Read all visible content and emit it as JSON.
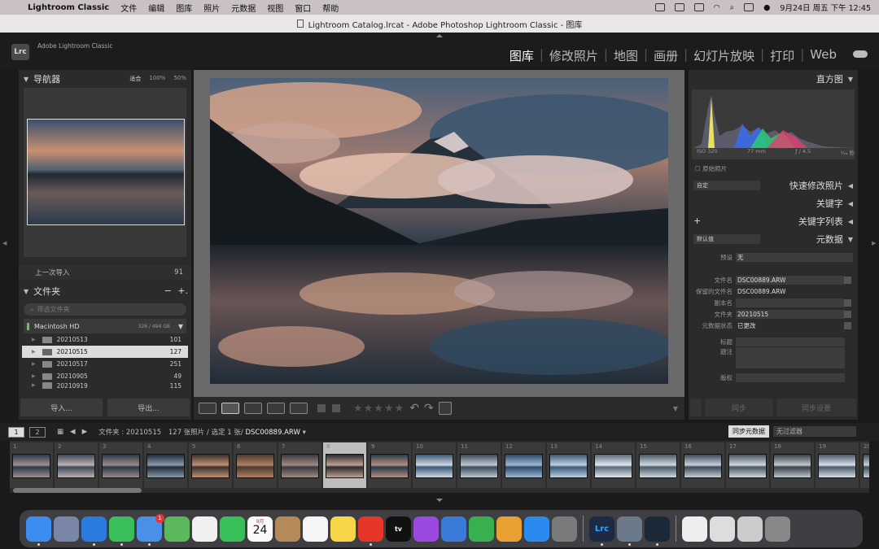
{
  "menubar": {
    "app": "Lightroom Classic",
    "items": [
      "文件",
      "编辑",
      "图库",
      "照片",
      "元数据",
      "视图",
      "窗口",
      "帮助"
    ],
    "clock": "9月24日 周五 下午 12:45"
  },
  "window": {
    "title": "Lightroom Catalog.lrcat - Adobe Photoshop Lightroom Classic - 图库"
  },
  "lr": {
    "logo": "Lrc",
    "brand": "Adobe Lightroom Classic",
    "modules": [
      "图库",
      "修改照片",
      "地图",
      "画册",
      "幻灯片放映",
      "打印",
      "Web"
    ],
    "active_module": "图库"
  },
  "navigator": {
    "title": "导航器",
    "zoom_options": [
      "适合",
      "100%",
      "50%"
    ],
    "selected_zoom": "适合"
  },
  "catalog": {
    "last_import_label": "上一次导入",
    "last_import_count": "91"
  },
  "folders": {
    "title": "文件夹",
    "minus": "−",
    "plus": "+.",
    "search_placeholder": "筛选文件夹",
    "volume_name": "Macintosh HD",
    "volume_size": "326 / 494 GB",
    "rows": [
      {
        "name": "20210513",
        "count": "101"
      },
      {
        "name": "20210515",
        "count": "127"
      },
      {
        "name": "20210517",
        "count": "251"
      },
      {
        "name": "20210905",
        "count": "49"
      },
      {
        "name": "20210919",
        "count": "115"
      }
    ],
    "selected_index": 1
  },
  "left_buttons": {
    "import": "导入...",
    "export": "导出..."
  },
  "toolbar": {
    "stars": "★★★★★"
  },
  "histogram": {
    "title": "直方图",
    "iso": "ISO 320",
    "focal": "77 mm",
    "aperture": "ƒ / 4.5",
    "shutter": "⅟₁₆ 秒",
    "original_label": "原始照片"
  },
  "right": {
    "quick_develop": "快速修改照片",
    "quick_preset": "自定",
    "keywords": "关键字",
    "keyword_list": "关键字列表",
    "plus": "+",
    "metadata": "元数据",
    "metadata_preset": "默认值",
    "preset_label": "预设",
    "preset_value": "无"
  },
  "metadata": [
    {
      "label": "文件名",
      "value": "DSC00889.ARW"
    },
    {
      "label": "保留的文件名",
      "value": "DSC00889.ARW"
    },
    {
      "label": "副本名",
      "value": ""
    },
    {
      "label": "文件夹",
      "value": "20210515"
    },
    {
      "label": "元数据状态",
      "value": "已更改"
    },
    {
      "label": "标题",
      "value": ""
    },
    {
      "label": "题注",
      "value": ""
    },
    {
      "label": "版权",
      "value": ""
    }
  ],
  "right_buttons": {
    "sync": "同步",
    "sync_settings": "同步设置"
  },
  "filmbar": {
    "page1": "1",
    "page2": "2",
    "path_prefix": "文件夹 : 20210515",
    "count": "127 张照片 / 选定 1 张/",
    "file": "DSC00889.ARW",
    "sync_meta": "同步元数据",
    "filter": "无过滤器"
  },
  "filmstrip": {
    "numbers": [
      "1",
      "2",
      "3",
      "4",
      "5",
      "6",
      "7",
      "8",
      "9",
      "10",
      "11",
      "12",
      "13",
      "14",
      "15",
      "16",
      "17",
      "18",
      "19",
      "20"
    ],
    "selected": 8
  },
  "dock": {
    "mail_badge": "1",
    "calendar_month": "9月",
    "calendar_day": "24",
    "lrc_label": "Lrc",
    "tv_label": "tv"
  },
  "colors": {
    "accent": "#dcdcdc",
    "panel": "#2b2b2b",
    "background": "#1c1c1c"
  }
}
